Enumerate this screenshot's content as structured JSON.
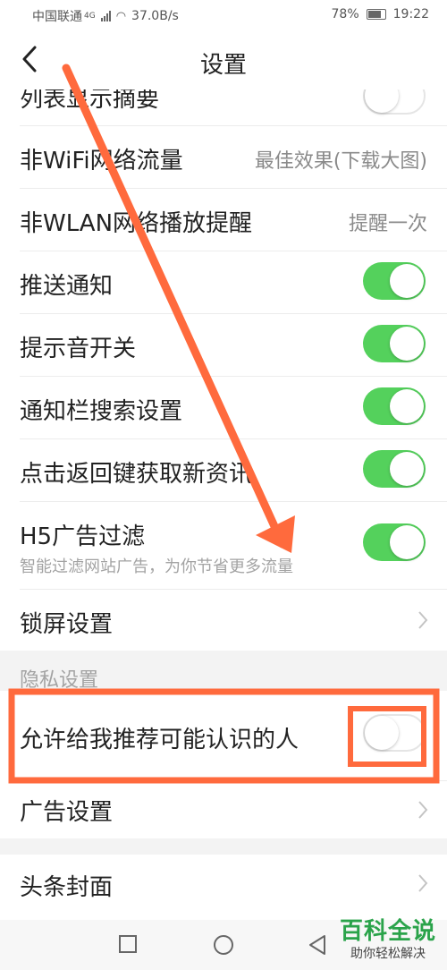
{
  "status": {
    "carrier": "中国联通",
    "network": "4G",
    "speed": "37.0B/s",
    "battery": "78%",
    "time": "19:22"
  },
  "header": {
    "title": "设置"
  },
  "rows": {
    "summary": {
      "label": "列表显示摘要",
      "toggle": "off"
    },
    "nonwifi": {
      "label": "非WiFi网络流量",
      "value": "最佳效果(下载大图)"
    },
    "nonwlan": {
      "label": "非WLAN网络播放提醒",
      "value": "提醒一次"
    },
    "push": {
      "label": "推送通知",
      "toggle": "on"
    },
    "sound": {
      "label": "提示音开关",
      "toggle": "on"
    },
    "notifsearch": {
      "label": "通知栏搜索设置",
      "toggle": "on"
    },
    "backkey": {
      "label": "点击返回键获取新资讯",
      "toggle": "on"
    },
    "h5": {
      "label": "H5广告过滤",
      "sub": "智能过滤网站广告，为你节省更多流量",
      "toggle": "on"
    },
    "lock": {
      "label": "锁屏设置"
    }
  },
  "privacy": {
    "header": "隐私设置",
    "recommend": {
      "label": "允许给我推荐可能认识的人",
      "toggle": "off"
    },
    "ads": {
      "label": "广告设置"
    }
  },
  "cover": {
    "label": "头条封面"
  },
  "watermark": {
    "title": "百科全说",
    "subtitle": "助你轻松解决"
  },
  "colors": {
    "toggle_on": "#54d15c",
    "annotation": "#ff6a3d"
  },
  "icons": [
    "back-arrow-icon",
    "chevron-right-icon",
    "home-square-icon",
    "home-circle-icon",
    "back-triangle-icon"
  ]
}
